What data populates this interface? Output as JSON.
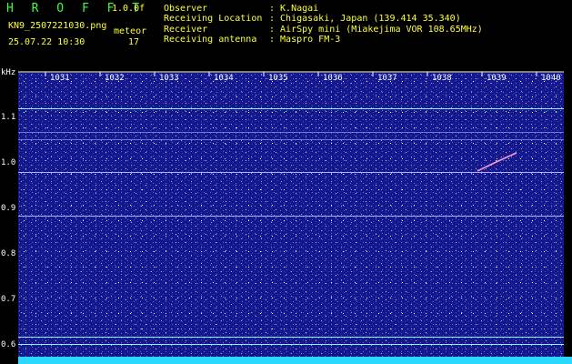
{
  "header": {
    "title": "H R O F F T",
    "version": "1.0.0f",
    "filename": "KN9_2507221030.png",
    "meteor_label": "meteor",
    "datetime": "25.07.22 10:30",
    "meteor_count": "17",
    "fields": [
      {
        "label": "Observer",
        "value": ": K.Nagai"
      },
      {
        "label": "Receiving Location",
        "value": ": Chigasaki, Japan (139.414 35.340)"
      },
      {
        "label": "Receiver",
        "value": ": AirSpy mini (Miakejima VOR 108.65MHz)"
      },
      {
        "label": "Receiving antenna",
        "value": ": Maspro FM-3"
      }
    ]
  },
  "axis": {
    "y_unit": "kHz",
    "y_ticks": [
      "1.1",
      "1.0",
      "0.9",
      "0.8",
      "0.7",
      "0.6"
    ],
    "x_ticks": [
      "1031",
      "1032",
      "1033",
      "1034",
      "1035",
      "1036",
      "1037",
      "1038",
      "1039",
      "1040"
    ]
  },
  "colors": {
    "background": "#000000",
    "spectrum": "#15188a",
    "header_green": "#3cff3c",
    "header_yellow": "#ffff3c",
    "carrier_cyan": "#8ff6ff",
    "amplitude_bar": "#2ad8ff"
  }
}
